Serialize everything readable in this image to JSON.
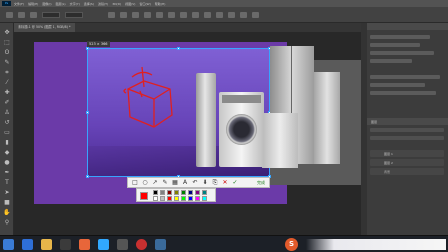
{
  "app": {
    "logo_text": "Ps",
    "menu": [
      "文件(F)",
      "编辑(E)",
      "图像(I)",
      "图层(L)",
      "文字(Y)",
      "选择(S)",
      "滤镜(T)",
      "3D(D)",
      "视图(V)",
      "窗口(W)",
      "帮助(H)"
    ]
  },
  "document": {
    "tab_title": "未标题-1 @ 50% (图层 1, RGB/8) *"
  },
  "selection": {
    "size_label": "523 × 366"
  },
  "screenshot_toolbar": {
    "tools": [
      "rectangle",
      "ellipse",
      "arrow",
      "pen",
      "mosaic",
      "text",
      "undo",
      "save",
      "copy",
      "cancel"
    ],
    "done_label": "完成"
  },
  "palette": {
    "colors": [
      "#000000",
      "#808080",
      "#800000",
      "#808000",
      "#008000",
      "#000080",
      "#800080",
      "#008080",
      "#ffffff",
      "#c0c0c0",
      "#ff0000",
      "#ffff00",
      "#00ff00",
      "#0000ff",
      "#ff00ff",
      "#00ffff"
    ],
    "selected": "#ff0000"
  },
  "panels": {
    "layers_title": "图层",
    "layer_names": [
      "图层 1",
      "图层 2",
      "背景"
    ]
  },
  "taskbar": {
    "apps": [
      "start",
      "file-explorer",
      "photoshop",
      "browser",
      "media",
      "sogou"
    ]
  },
  "colors": {
    "accent": "#38a4ff",
    "canvas_purple": "#6b3aa8",
    "marker_red": "#e02020"
  }
}
